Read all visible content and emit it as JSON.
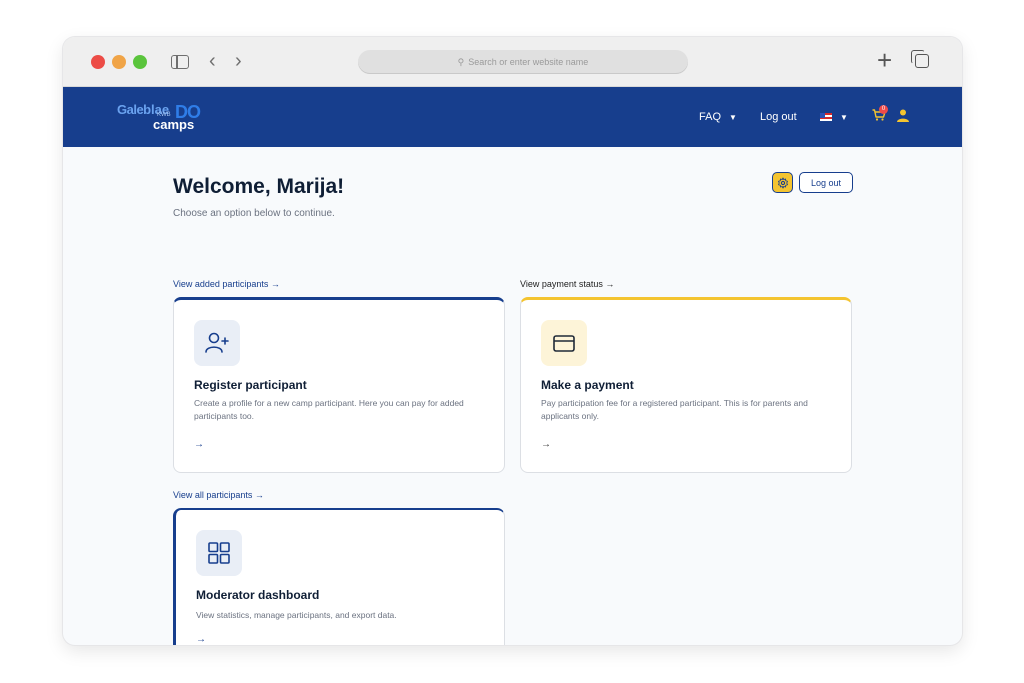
{
  "browser": {
    "url_placeholder": "Search or enter website name"
  },
  "header": {
    "faq_label": "FAQ",
    "logout_label": "Log out",
    "cart_count": "0",
    "logo": {
      "line1": "Galeb",
      "line1b": "lae",
      "sub": "KWB",
      "do": "DO",
      "camps": "camps"
    }
  },
  "main": {
    "welcome": "Welcome, Marija!",
    "subtitle": "Choose an option below to continue.",
    "logout_button": "Log out",
    "links": {
      "added": "View added participants →",
      "payment": "View payment status →",
      "all": "View all participants →"
    },
    "cards": [
      {
        "title": "Register participant",
        "desc": "Create a profile for a new camp participant. Here you can pay for added participants too.",
        "arrow": "→"
      },
      {
        "title": "Make a payment",
        "desc": "Pay participation fee for a registered participant. This is for parents and applicants only.",
        "arrow": "→"
      },
      {
        "title": "Moderator dashboard",
        "desc": "View statistics, manage participants, and export data.",
        "arrow": "→"
      }
    ]
  },
  "colors": {
    "brand_blue": "#173e8d",
    "accent_yellow": "#f4c430"
  },
  "icons": [
    "sidebar-icon",
    "back-icon",
    "forward-icon",
    "search-icon",
    "plus-icon",
    "tabs-icon",
    "caret-down-icon",
    "flag-us-icon",
    "cart-icon",
    "user-icon",
    "gear-icon",
    "user-plus-icon",
    "credit-card-icon",
    "grid-icon",
    "arrow-right-icon"
  ]
}
